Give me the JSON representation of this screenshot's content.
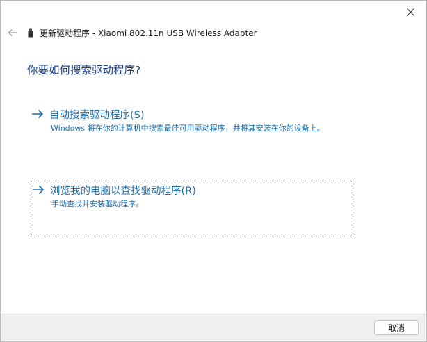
{
  "window": {
    "title": "更新驱动程序 - Xiaomi 802.11n USB Wireless Adapter",
    "back_icon": "back-arrow-icon",
    "device_icon": "usb-device-icon",
    "close_icon": "close-icon"
  },
  "main": {
    "question": "你要如何搜索驱动程序?",
    "options": [
      {
        "title": "自动搜索驱动程序(S)",
        "description": "Windows 将在你的计算机中搜索最佳可用驱动程序，并将其安装在你的设备上。",
        "icon": "arrow-right-icon"
      },
      {
        "title": "浏览我的电脑以查找驱动程序(R)",
        "description": "手动查找并安装驱动程序。",
        "icon": "arrow-right-icon"
      }
    ]
  },
  "footer": {
    "cancel_label": "取消"
  },
  "colors": {
    "link": "#1a6dae",
    "heading": "#1c3f8c",
    "footer_bg": "#f0f0f0"
  }
}
